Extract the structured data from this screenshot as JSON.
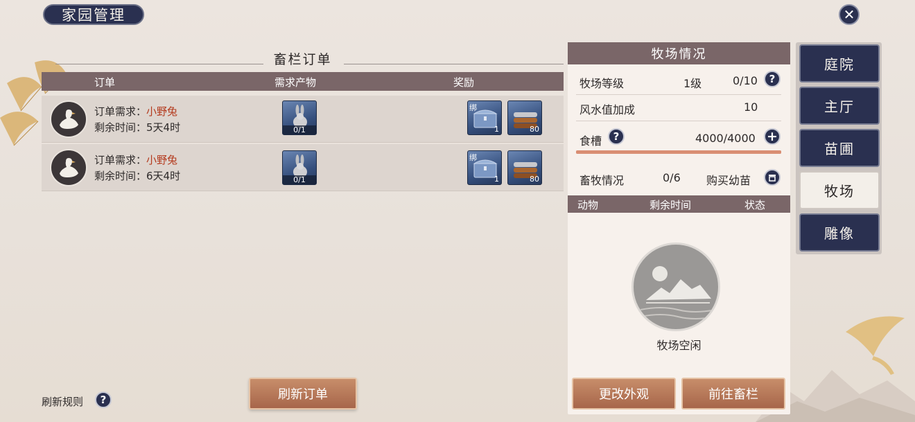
{
  "header": {
    "title": "家园管理",
    "close_icon": "close-icon"
  },
  "orders": {
    "section_title": "畜栏订单",
    "columns": {
      "order": "订单",
      "demand": "需求产物",
      "reward": "奖励"
    },
    "rows": [
      {
        "demand_label": "订单需求：",
        "demand_item": "小野兔",
        "time_label": "剩余时间：",
        "time_value": "5天4时",
        "product_count": "0/1",
        "reward_chest_badge": "绑",
        "reward_chest_count": "1",
        "reward_wood_count": "80"
      },
      {
        "demand_label": "订单需求：",
        "demand_item": "小野兔",
        "time_label": "剩余时间：",
        "time_value": "6天4时",
        "product_count": "0/1",
        "reward_chest_badge": "绑",
        "reward_chest_count": "1",
        "reward_wood_count": "80"
      }
    ],
    "refresh_button": "刷新订单",
    "refresh_rules": "刷新规则"
  },
  "ranch": {
    "title": "牧场情况",
    "level_label": "牧场等级",
    "level_value": "1级",
    "level_progress": "0/10",
    "fengshui_label": "风水值加成",
    "fengshui_value": "10",
    "trough_label": "食槽",
    "trough_value": "4000/4000",
    "trough_fill_fraction": 1.0,
    "livestock_label": "畜牧情况",
    "livestock_value": "0/6",
    "buy_seedling_label": "购买幼苗",
    "table_headers": {
      "animal": "动物",
      "remaining_time": "剩余时间",
      "status": "状态"
    },
    "empty_text": "牧场空闲",
    "change_look_button": "更改外观",
    "goto_pen_button": "前往畜栏"
  },
  "tabs": [
    {
      "label": "庭院",
      "active": false
    },
    {
      "label": "主厅",
      "active": false
    },
    {
      "label": "苗圃",
      "active": false
    },
    {
      "label": "牧场",
      "active": true
    },
    {
      "label": "雕像",
      "active": false
    }
  ],
  "colors": {
    "navy": "#2a3050",
    "header_brown": "#7a6668",
    "button_brown": "#a7664a",
    "highlight_red": "#b43a1e"
  }
}
